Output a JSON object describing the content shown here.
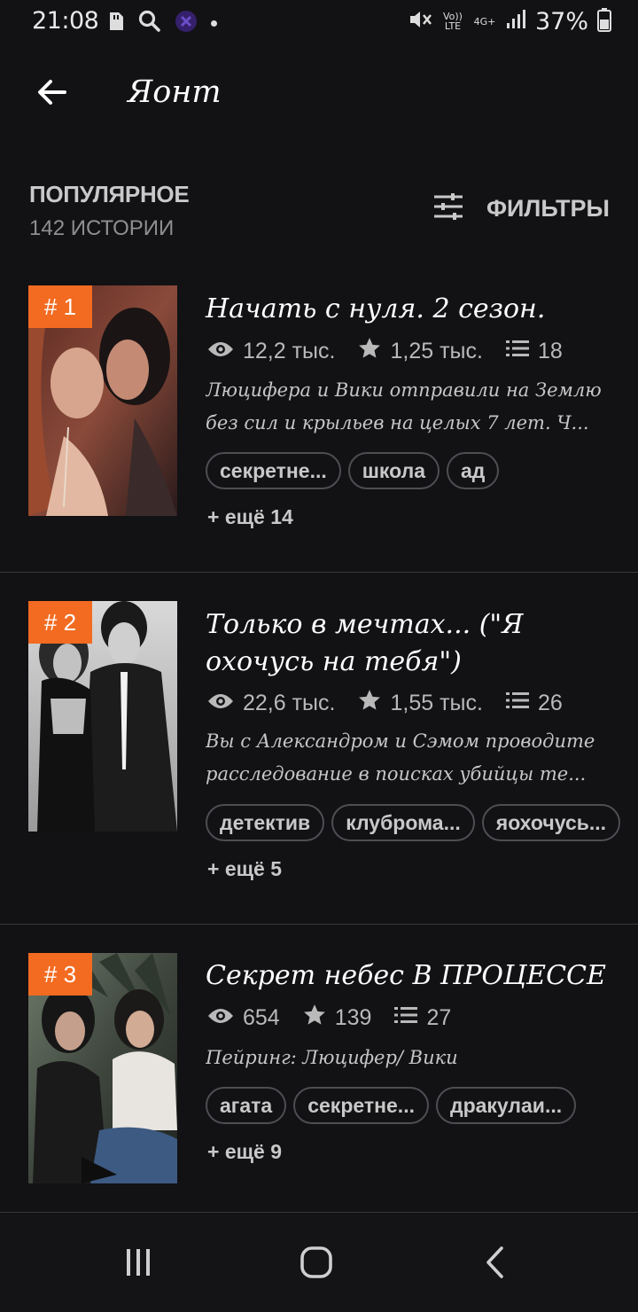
{
  "status_bar": {
    "time": "21:08",
    "battery": "37%",
    "icons": [
      "sd-card-icon",
      "search-icon",
      "app-icon",
      "dot-icon",
      "mute-icon",
      "volte-icon",
      "4g-icon",
      "signal-icon",
      "battery-icon"
    ],
    "volte_label": "Vo)) LTE",
    "net_label": "4G+"
  },
  "app_bar": {
    "title": "Яонт"
  },
  "section": {
    "title": "ПОПУЛЯРНОЕ",
    "subtitle": "142 ИСТОРИИ",
    "filter_label": "ФИЛЬТРЫ"
  },
  "stories": [
    {
      "rank": "# 1",
      "title": "Начать с нуля. 2 сезон.",
      "views": "12,2 тыс.",
      "votes": "1,25 тыс.",
      "parts": "18",
      "desc_lines": [
        "Люцифера и Вики отправили на Землю",
        "без сил и крыльев на целых 7 лет. Ч..."
      ],
      "tags": [
        "секретне...",
        "школа",
        "ад"
      ],
      "more": "+ ещё 14"
    },
    {
      "rank": "# 2",
      "title": "Только в мечтах... (\"Я охочусь на тебя\")",
      "views": "22,6 тыс.",
      "votes": "1,55 тыс.",
      "parts": "26",
      "desc_lines": [
        "Вы с Александром и Сэмом проводите",
        "расследование в поисках убийцы те..."
      ],
      "tags": [
        "детектив",
        "клуброма...",
        "яохочусь..."
      ],
      "more": "+ ещё 5"
    },
    {
      "rank": "# 3",
      "title": "Секрет небес  В ПРОЦЕССЕ",
      "views": "654",
      "votes": "139",
      "parts": "27",
      "desc_lines": [
        "Пейринг: Люцифер/ Вики"
      ],
      "tags": [
        "агата",
        "секретне...",
        "дракулаи..."
      ],
      "more": "+ ещё 9"
    }
  ],
  "colors": {
    "background": "#121114",
    "rank_badge": "#f26b21",
    "divider": "#3a393d"
  }
}
